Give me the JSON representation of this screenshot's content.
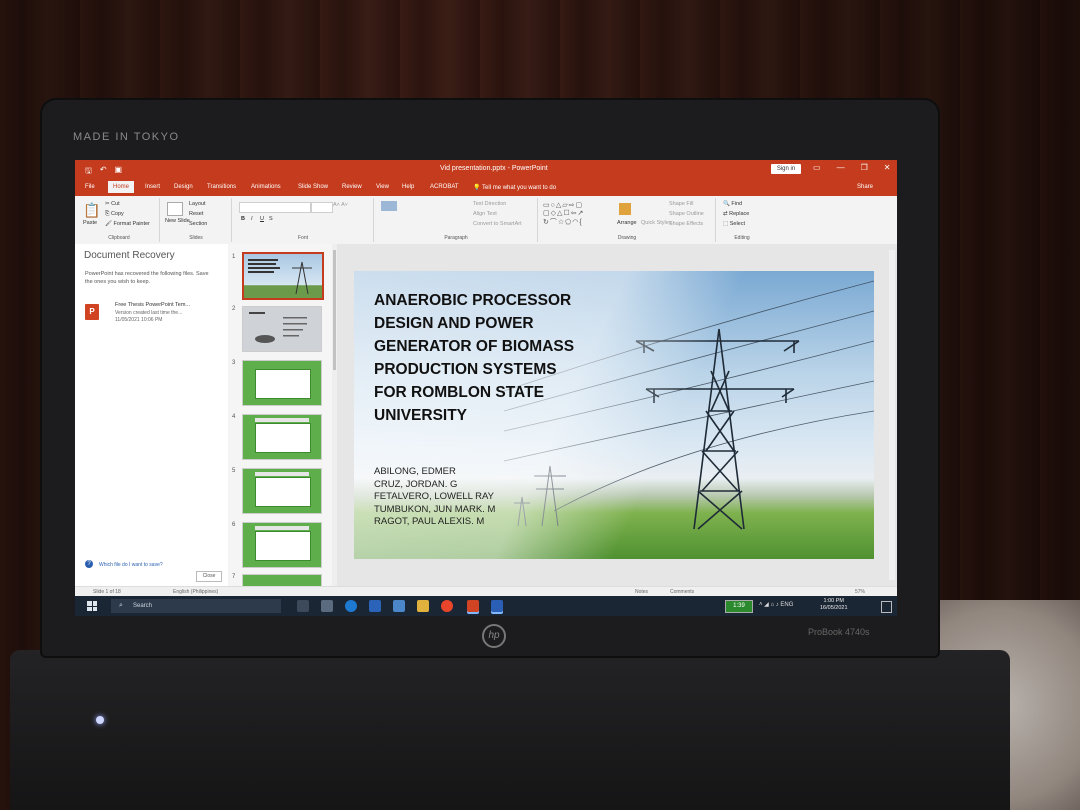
{
  "app": {
    "window_title": "Vid presentation.pptx  -  PowerPoint",
    "sign_in": "Sign in",
    "window_buttons": [
      "▭",
      "—",
      "❐",
      "✕"
    ],
    "brand_text": "MADE IN TOKYO",
    "model_text": "ProBook 4740s"
  },
  "tabs": {
    "items": [
      "File",
      "Home",
      "Insert",
      "Design",
      "Transitions",
      "Animations",
      "Slide Show",
      "Review",
      "View",
      "Help",
      "ACROBAT"
    ],
    "tell_me": "Tell me what you want to do",
    "share": "Share"
  },
  "ribbon": {
    "clipboard": {
      "paste": "Paste",
      "cut": "Cut",
      "copy": "Copy",
      "format_painter": "Format Painter",
      "label": "Clipboard"
    },
    "slides": {
      "new_slide": "New Slide",
      "layout": "Layout",
      "reset": "Reset",
      "section": "Section",
      "label": "Slides"
    },
    "font": {
      "bold": "B",
      "italic": "I",
      "underline": "U",
      "strike": "S",
      "label": "Font"
    },
    "paragraph": {
      "text_direction": "Text Direction",
      "align_text": "Align Text",
      "smartart": "Convert to SmartArt",
      "label": "Paragraph"
    },
    "drawing": {
      "arrange": "Arrange",
      "quick_styles": "Quick Styles",
      "shape_fill": "Shape Fill",
      "shape_outline": "Shape Outline",
      "shape_effects": "Shape Effects",
      "label": "Drawing"
    },
    "editing": {
      "find": "Find",
      "replace": "Replace",
      "select": "Select",
      "label": "Editing"
    }
  },
  "recovery": {
    "title": "Document Recovery",
    "description": "PowerPoint has recovered the following files. Save the ones you wish to keep.",
    "file_name": "Free Thesis PowerPoint Tem...",
    "file_desc": "Version created last time the...",
    "file_date": "11/05/2021 10:06 PM",
    "help_link": "Which file do I want to save?",
    "close": "Close"
  },
  "thumbnails": [
    "1",
    "2",
    "3",
    "4",
    "5",
    "6",
    "7"
  ],
  "slide": {
    "title_lines": [
      "ANAEROBIC PROCESSOR",
      "DESIGN AND POWER",
      "GENERATOR OF  BIOMASS",
      "PRODUCTION SYSTEMS",
      "FOR ROMBLON STATE",
      "UNIVERSITY"
    ],
    "authors": [
      "ABILONG, EDMER",
      "CRUZ, JORDAN. G",
      "FETALVERO, LOWELL RAY",
      "TUMBUKON, JUN MARK. M",
      "RAGOT, PAUL ALEXIS. M"
    ]
  },
  "status": {
    "slide_of": "Slide 1 of 18",
    "language": "English (Philippines)",
    "notes": "Notes",
    "comments": "Comments",
    "zoom": "57%"
  },
  "taskbar": {
    "search": "Search",
    "battery": "1:39",
    "tray": "ENG",
    "time": "1:00 PM",
    "date": "16/05/2021"
  }
}
